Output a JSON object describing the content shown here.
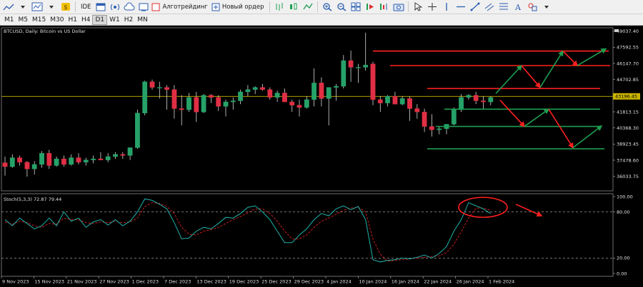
{
  "toolbar": {
    "algo_label": "Алготрейдинг",
    "new_order_label": "Новый ордер",
    "ide_label": "IDE"
  },
  "timeframes": [
    "M1",
    "M5",
    "M15",
    "M30",
    "H1",
    "H4",
    "D1",
    "W1",
    "H2",
    "MN"
  ],
  "active_timeframe": "D1",
  "chart": {
    "symbol_label": "BTCUSD, Daily:  Bitcoin vs US Dollar",
    "indicator_label": "Stoch(5,3,3) 72.87 79.44",
    "current_price": "43196.45",
    "price_ticks": [
      "49037.40",
      "47592.55",
      "46147.70",
      "44702.85",
      "43258.00",
      "41813.15",
      "40368.30",
      "38923.45",
      "37478.60",
      "36033.75"
    ],
    "osc_ticks": [
      "100.00",
      "80.00",
      "20.00",
      "0.00"
    ],
    "date_ticks": [
      "9 Nov 2023",
      "15 Nov 2023",
      "21 Nov 2023",
      "27 Nov 2023",
      "1 Dec 2023",
      "7 Dec 2023",
      "13 Dec 2023",
      "19 Dec 2023",
      "25 Dec 2023",
      "29 Dec 2023",
      "4 Jan 2024",
      "10 Jan 2024",
      "16 Jan 2024",
      "22 Jan 2024",
      "26 Jan 2024",
      "1 Feb 2024"
    ]
  },
  "colors": {
    "bull": "#26a269",
    "bear": "#e02f44",
    "price_line": "#c8b400",
    "stoch_main": "#20b2aa",
    "stoch_signal": "#e02020",
    "level_red": "#ff2020",
    "level_green": "#1e9e50"
  },
  "candles": [
    [
      37250,
      37800,
      36100,
      36900
    ],
    [
      36900,
      38000,
      36800,
      37700
    ],
    [
      37700,
      37900,
      37000,
      37300
    ],
    [
      37300,
      37400,
      36000,
      36700
    ],
    [
      36700,
      37400,
      36200,
      37100
    ],
    [
      37100,
      38300,
      36800,
      38100
    ],
    [
      38100,
      38400,
      36700,
      37000
    ],
    [
      37000,
      37800,
      36900,
      37600
    ],
    [
      37600,
      37900,
      36900,
      37100
    ],
    [
      37100,
      38000,
      37000,
      37700
    ],
    [
      37700,
      38100,
      37100,
      37300
    ],
    [
      37300,
      37700,
      37000,
      37500
    ],
    [
      37500,
      37900,
      37200,
      37600
    ],
    [
      37600,
      38200,
      37500,
      37500
    ],
    [
      37500,
      38100,
      37300,
      37800
    ],
    [
      37800,
      38200,
      37600,
      38000
    ],
    [
      38000,
      38200,
      37600,
      37900
    ],
    [
      37900,
      38500,
      37500,
      38600
    ],
    [
      38600,
      42000,
      38500,
      41700
    ],
    [
      41700,
      44600,
      41500,
      44500
    ],
    [
      44500,
      44700,
      43800,
      44000
    ],
    [
      44000,
      44500,
      43000,
      44000
    ],
    [
      44000,
      44200,
      42000,
      43800
    ],
    [
      43800,
      44200,
      41200,
      42100
    ],
    [
      42100,
      43300,
      40600,
      42000
    ],
    [
      42000,
      43500,
      41800,
      43100
    ],
    [
      43100,
      43600,
      40900,
      41800
    ],
    [
      41800,
      43400,
      41700,
      43300
    ],
    [
      43300,
      43400,
      42600,
      43100
    ],
    [
      43100,
      43300,
      41900,
      42300
    ],
    [
      42300,
      42900,
      41400,
      42700
    ],
    [
      42700,
      43100,
      42000,
      42800
    ],
    [
      42800,
      43800,
      42500,
      43600
    ],
    [
      43600,
      44200,
      43200,
      43800
    ],
    [
      43800,
      44100,
      43400,
      44000
    ],
    [
      44000,
      44300,
      43700,
      43800
    ],
    [
      43800,
      44000,
      42900,
      43100
    ],
    [
      43100,
      43700,
      42700,
      43500
    ],
    [
      43500,
      43900,
      42900,
      42700
    ],
    [
      42700,
      42900,
      41800,
      42400
    ],
    [
      42400,
      42900,
      41400,
      42200
    ],
    [
      42200,
      43200,
      42100,
      42900
    ],
    [
      42900,
      45700,
      42300,
      44400
    ],
    [
      44400,
      44900,
      42300,
      43000
    ],
    [
      43000,
      43600,
      40600,
      44000
    ],
    [
      44000,
      44300,
      42800,
      44100
    ],
    [
      44100,
      46900,
      43900,
      46400
    ],
    [
      46400,
      47300,
      44500,
      45800
    ],
    [
      45800,
      46100,
      44400,
      45800
    ],
    [
      45800,
      48900,
      45500,
      46000
    ],
    [
      46100,
      46300,
      42400,
      42900
    ],
    [
      42900,
      43200,
      41800,
      42600
    ],
    [
      42600,
      43300,
      42300,
      43200
    ],
    [
      43200,
      43600,
      42500,
      42500
    ],
    [
      42500,
      43200,
      42400,
      43000
    ],
    [
      43000,
      43200,
      41000,
      42100
    ],
    [
      42100,
      42500,
      41200,
      41800
    ],
    [
      41800,
      42100,
      40000,
      40500
    ],
    [
      40500,
      41600,
      39600,
      40200
    ],
    [
      40200,
      40500,
      39800,
      40300
    ],
    [
      40300,
      40700,
      39800,
      40700
    ],
    [
      40700,
      42200,
      40600,
      42000
    ],
    [
      42000,
      43400,
      41800,
      43100
    ],
    [
      43100,
      43400,
      42900,
      43300
    ],
    [
      43300,
      43600,
      42500,
      42800
    ],
    [
      42800,
      43200,
      42000,
      42700
    ],
    [
      42700,
      43200,
      42400,
      43100
    ]
  ],
  "stoch_main": [
    70,
    62,
    72,
    65,
    58,
    62,
    72,
    62,
    80,
    68,
    72,
    60,
    67,
    70,
    63,
    70,
    62,
    68,
    80,
    97,
    95,
    90,
    84,
    66,
    45,
    46,
    55,
    60,
    58,
    65,
    73,
    72,
    78,
    86,
    88,
    80,
    70,
    55,
    40,
    40,
    50,
    58,
    70,
    78,
    75,
    84,
    88,
    83,
    87,
    70,
    18,
    15,
    17,
    18,
    20,
    19,
    21,
    24,
    20,
    26,
    35,
    55,
    70,
    92,
    88,
    84,
    78
  ],
  "stoch_signal": [
    67,
    64,
    68,
    66,
    62,
    60,
    65,
    64,
    72,
    70,
    70,
    66,
    65,
    67,
    66,
    68,
    66,
    67,
    72,
    87,
    92,
    91,
    87,
    78,
    60,
    51,
    50,
    55,
    57,
    60,
    65,
    70,
    74,
    79,
    84,
    84,
    78,
    68,
    55,
    45,
    45,
    50,
    60,
    68,
    72,
    77,
    82,
    85,
    86,
    80,
    45,
    25,
    16,
    17,
    18,
    19,
    20,
    21,
    22,
    23,
    27,
    38,
    54,
    72,
    85,
    85,
    82
  ]
}
